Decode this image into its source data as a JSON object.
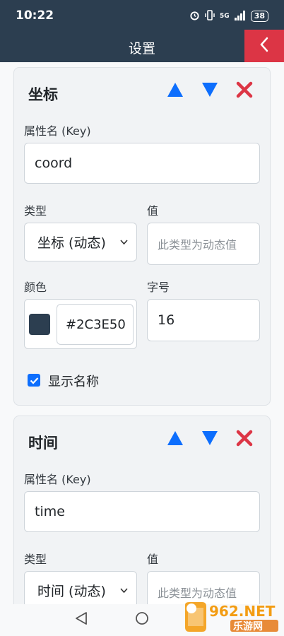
{
  "status_bar": {
    "time": "10:22",
    "network": "5G",
    "battery": "38"
  },
  "header": {
    "title": "设置"
  },
  "cards": [
    {
      "title": "坐标",
      "key_label": "属性名 (Key)",
      "key_value": "coord",
      "type_label": "类型",
      "type_value": "坐标 (动态)",
      "value_label": "值",
      "value_placeholder": "此类型为动态值",
      "color_label": "颜色",
      "color_hex": "#2C3E50",
      "fontsize_label": "字号",
      "fontsize_value": "16",
      "show_name_label": "显示名称",
      "show_name_checked": true
    },
    {
      "title": "时间",
      "key_label": "属性名 (Key)",
      "key_value": "time",
      "type_label": "类型",
      "type_value": "时间 (动态)",
      "value_label": "值",
      "value_placeholder": "此类型为动态值"
    }
  ],
  "colors": {
    "header_bg": "#2C3E50",
    "accent_blue": "#0D6EFD",
    "danger_red": "#DC3545"
  },
  "watermark": {
    "text_top": "962.NET",
    "text_bottom": "乐游网"
  }
}
